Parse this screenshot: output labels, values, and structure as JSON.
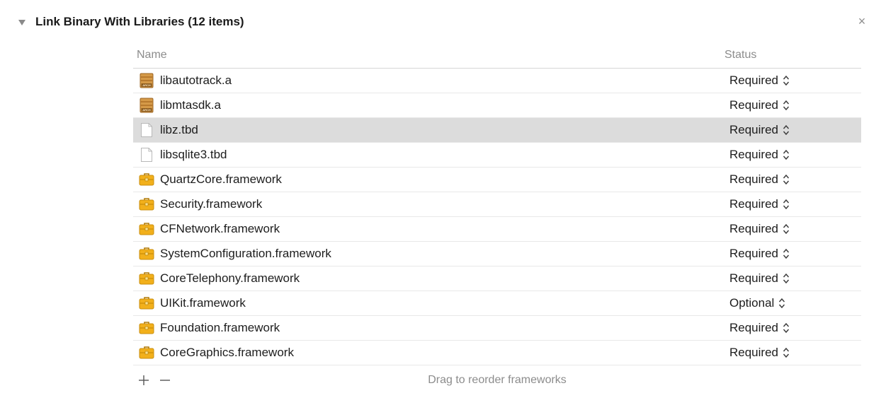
{
  "section": {
    "title": "Link Binary With Libraries (12 items)",
    "close_label": "×"
  },
  "table": {
    "columns": {
      "name": "Name",
      "status": "Status"
    },
    "rows": [
      {
        "name": "libautotrack.a",
        "status": "Required",
        "icon": "archive-library-icon",
        "selected": false
      },
      {
        "name": "libmtasdk.a",
        "status": "Required",
        "icon": "archive-library-icon",
        "selected": false
      },
      {
        "name": "libz.tbd",
        "status": "Required",
        "icon": "document-icon",
        "selected": true
      },
      {
        "name": "libsqlite3.tbd",
        "status": "Required",
        "icon": "document-icon",
        "selected": false
      },
      {
        "name": "QuartzCore.framework",
        "status": "Required",
        "icon": "framework-toolbox-icon",
        "selected": false
      },
      {
        "name": "Security.framework",
        "status": "Required",
        "icon": "framework-toolbox-icon",
        "selected": false
      },
      {
        "name": "CFNetwork.framework",
        "status": "Required",
        "icon": "framework-toolbox-icon",
        "selected": false
      },
      {
        "name": "SystemConfiguration.framework",
        "status": "Required",
        "icon": "framework-toolbox-icon",
        "selected": false
      },
      {
        "name": "CoreTelephony.framework",
        "status": "Required",
        "icon": "framework-toolbox-icon",
        "selected": false
      },
      {
        "name": "UIKit.framework",
        "status": "Optional",
        "icon": "framework-toolbox-icon",
        "selected": false
      },
      {
        "name": "Foundation.framework",
        "status": "Required",
        "icon": "framework-toolbox-icon",
        "selected": false
      },
      {
        "name": "CoreGraphics.framework",
        "status": "Required",
        "icon": "framework-toolbox-icon",
        "selected": false
      }
    ]
  },
  "footer": {
    "add_label": "+",
    "remove_label": "−",
    "hint": "Drag to reorder frameworks"
  },
  "colors": {
    "selected_row": "#dcdcdc",
    "framework_icon": "#f0b21a",
    "archive_icon": "#c8893a"
  }
}
